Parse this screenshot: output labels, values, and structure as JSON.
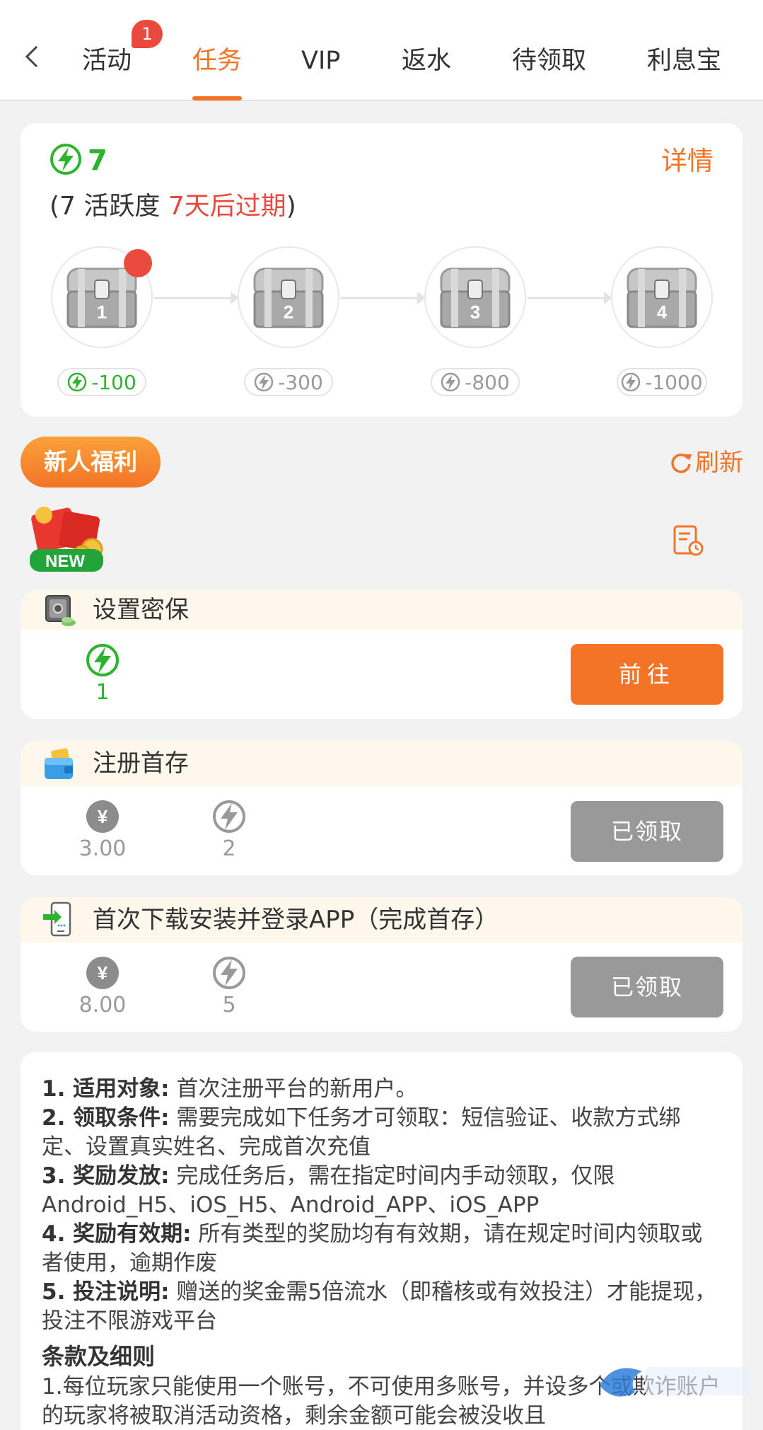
{
  "nav": {
    "tabs": [
      {
        "label": "活动"
      },
      {
        "label": "任务"
      },
      {
        "label": "VIP"
      },
      {
        "label": "返水"
      },
      {
        "label": "待领取"
      },
      {
        "label": "利息宝"
      }
    ],
    "active_tab": "任务",
    "badge_count": "1"
  },
  "activity": {
    "points": "7",
    "details_label": "详情",
    "paren_open": "(",
    "activity_text": "7 活跃度 ",
    "expire_text": "7天后过期",
    "paren_close": ")",
    "chests": [
      {
        "number": "1",
        "cost": "-100",
        "active": true
      },
      {
        "number": "2",
        "cost": "-300",
        "active": false
      },
      {
        "number": "3",
        "cost": "-800",
        "active": false
      },
      {
        "number": "4",
        "cost": "-1000",
        "active": false
      }
    ]
  },
  "section": {
    "newbie_label": "新人福利",
    "refresh_label": "刷新",
    "new_badge_text": "NEW"
  },
  "tasks": [
    {
      "title": "设置密保",
      "rewards": [
        {
          "type": "bolt",
          "value": "1",
          "color": "#2db32d"
        }
      ],
      "button": "前往",
      "button_state": "go"
    },
    {
      "title": "注册首存",
      "rewards": [
        {
          "type": "yen",
          "value": "3.00"
        },
        {
          "type": "bolt",
          "value": "2"
        }
      ],
      "button": "已领取",
      "button_state": "done"
    },
    {
      "title": "首次下载安装并登录APP（完成首存）",
      "rewards": [
        {
          "type": "yen",
          "value": "8.00"
        },
        {
          "type": "bolt",
          "value": "5"
        }
      ],
      "button": "已领取",
      "button_state": "done"
    }
  ],
  "rules": {
    "items": [
      {
        "head": "1. 适用对象:",
        "text": " 首次注册平台的新用户。"
      },
      {
        "head": "2. 领取条件:",
        "text": " 需要完成如下任务才可领取：短信验证、收款方式绑定、设置真实姓名、完成首次充值"
      },
      {
        "head": "3. 奖励发放:",
        "text": " 完成任务后，需在指定时间内手动领取，仅限Android_H5、iOS_H5、Android_APP、iOS_APP"
      },
      {
        "head": "4. 奖励有效期:",
        "text": " 所有类型的奖励均有有效期，请在规定时间内领取或者使用，逾期作废"
      },
      {
        "head": "5. 投注说明:",
        "text": " 赠送的奖金需5倍流水（即稽核或有效投注）才能提现，投注不限游戏平台"
      }
    ],
    "terms_title": "条款及细则",
    "terms_text": "1.每位玩家只能使用一个账号，不可使用多账号，并设多个或欺诈账户的玩家将被取消活动资格，剩余金额可能会被没收且"
  },
  "colors": {
    "accent": "#f47427",
    "green": "#2db32d",
    "red": "#ea4a3d",
    "gray_button": "#999999"
  }
}
